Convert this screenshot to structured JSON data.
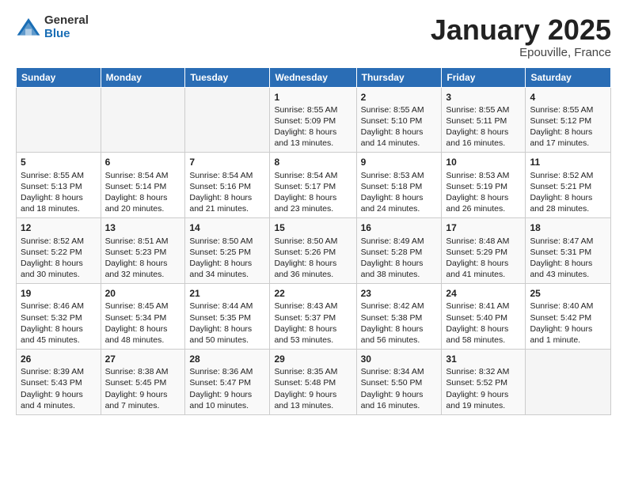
{
  "logo": {
    "general": "General",
    "blue": "Blue"
  },
  "title": {
    "month": "January 2025",
    "location": "Epouville, France"
  },
  "weekdays": [
    "Sunday",
    "Monday",
    "Tuesday",
    "Wednesday",
    "Thursday",
    "Friday",
    "Saturday"
  ],
  "weeks": [
    [
      {
        "day": "",
        "info": ""
      },
      {
        "day": "",
        "info": ""
      },
      {
        "day": "",
        "info": ""
      },
      {
        "day": "1",
        "info": "Sunrise: 8:55 AM\nSunset: 5:09 PM\nDaylight: 8 hours\nand 13 minutes."
      },
      {
        "day": "2",
        "info": "Sunrise: 8:55 AM\nSunset: 5:10 PM\nDaylight: 8 hours\nand 14 minutes."
      },
      {
        "day": "3",
        "info": "Sunrise: 8:55 AM\nSunset: 5:11 PM\nDaylight: 8 hours\nand 16 minutes."
      },
      {
        "day": "4",
        "info": "Sunrise: 8:55 AM\nSunset: 5:12 PM\nDaylight: 8 hours\nand 17 minutes."
      }
    ],
    [
      {
        "day": "5",
        "info": "Sunrise: 8:55 AM\nSunset: 5:13 PM\nDaylight: 8 hours\nand 18 minutes."
      },
      {
        "day": "6",
        "info": "Sunrise: 8:54 AM\nSunset: 5:14 PM\nDaylight: 8 hours\nand 20 minutes."
      },
      {
        "day": "7",
        "info": "Sunrise: 8:54 AM\nSunset: 5:16 PM\nDaylight: 8 hours\nand 21 minutes."
      },
      {
        "day": "8",
        "info": "Sunrise: 8:54 AM\nSunset: 5:17 PM\nDaylight: 8 hours\nand 23 minutes."
      },
      {
        "day": "9",
        "info": "Sunrise: 8:53 AM\nSunset: 5:18 PM\nDaylight: 8 hours\nand 24 minutes."
      },
      {
        "day": "10",
        "info": "Sunrise: 8:53 AM\nSunset: 5:19 PM\nDaylight: 8 hours\nand 26 minutes."
      },
      {
        "day": "11",
        "info": "Sunrise: 8:52 AM\nSunset: 5:21 PM\nDaylight: 8 hours\nand 28 minutes."
      }
    ],
    [
      {
        "day": "12",
        "info": "Sunrise: 8:52 AM\nSunset: 5:22 PM\nDaylight: 8 hours\nand 30 minutes."
      },
      {
        "day": "13",
        "info": "Sunrise: 8:51 AM\nSunset: 5:23 PM\nDaylight: 8 hours\nand 32 minutes."
      },
      {
        "day": "14",
        "info": "Sunrise: 8:50 AM\nSunset: 5:25 PM\nDaylight: 8 hours\nand 34 minutes."
      },
      {
        "day": "15",
        "info": "Sunrise: 8:50 AM\nSunset: 5:26 PM\nDaylight: 8 hours\nand 36 minutes."
      },
      {
        "day": "16",
        "info": "Sunrise: 8:49 AM\nSunset: 5:28 PM\nDaylight: 8 hours\nand 38 minutes."
      },
      {
        "day": "17",
        "info": "Sunrise: 8:48 AM\nSunset: 5:29 PM\nDaylight: 8 hours\nand 41 minutes."
      },
      {
        "day": "18",
        "info": "Sunrise: 8:47 AM\nSunset: 5:31 PM\nDaylight: 8 hours\nand 43 minutes."
      }
    ],
    [
      {
        "day": "19",
        "info": "Sunrise: 8:46 AM\nSunset: 5:32 PM\nDaylight: 8 hours\nand 45 minutes."
      },
      {
        "day": "20",
        "info": "Sunrise: 8:45 AM\nSunset: 5:34 PM\nDaylight: 8 hours\nand 48 minutes."
      },
      {
        "day": "21",
        "info": "Sunrise: 8:44 AM\nSunset: 5:35 PM\nDaylight: 8 hours\nand 50 minutes."
      },
      {
        "day": "22",
        "info": "Sunrise: 8:43 AM\nSunset: 5:37 PM\nDaylight: 8 hours\nand 53 minutes."
      },
      {
        "day": "23",
        "info": "Sunrise: 8:42 AM\nSunset: 5:38 PM\nDaylight: 8 hours\nand 56 minutes."
      },
      {
        "day": "24",
        "info": "Sunrise: 8:41 AM\nSunset: 5:40 PM\nDaylight: 8 hours\nand 58 minutes."
      },
      {
        "day": "25",
        "info": "Sunrise: 8:40 AM\nSunset: 5:42 PM\nDaylight: 9 hours\nand 1 minute."
      }
    ],
    [
      {
        "day": "26",
        "info": "Sunrise: 8:39 AM\nSunset: 5:43 PM\nDaylight: 9 hours\nand 4 minutes."
      },
      {
        "day": "27",
        "info": "Sunrise: 8:38 AM\nSunset: 5:45 PM\nDaylight: 9 hours\nand 7 minutes."
      },
      {
        "day": "28",
        "info": "Sunrise: 8:36 AM\nSunset: 5:47 PM\nDaylight: 9 hours\nand 10 minutes."
      },
      {
        "day": "29",
        "info": "Sunrise: 8:35 AM\nSunset: 5:48 PM\nDaylight: 9 hours\nand 13 minutes."
      },
      {
        "day": "30",
        "info": "Sunrise: 8:34 AM\nSunset: 5:50 PM\nDaylight: 9 hours\nand 16 minutes."
      },
      {
        "day": "31",
        "info": "Sunrise: 8:32 AM\nSunset: 5:52 PM\nDaylight: 9 hours\nand 19 minutes."
      },
      {
        "day": "",
        "info": ""
      }
    ]
  ]
}
